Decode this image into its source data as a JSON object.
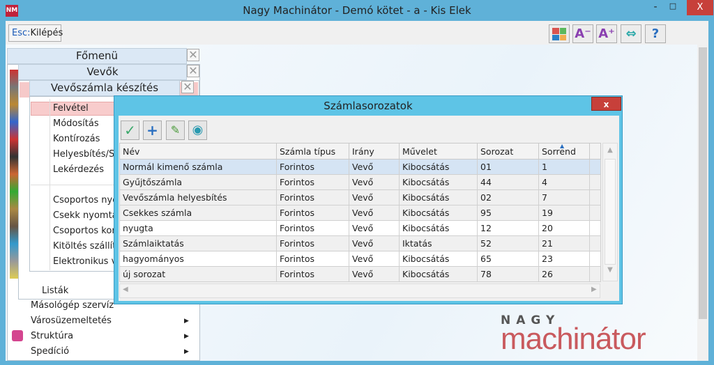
{
  "window": {
    "title": "Nagy Machinátor - Demó kötet - a - Kis Elek",
    "logo": "NM",
    "minimize": "-",
    "maximize": "□",
    "close": "X"
  },
  "toolbar": {
    "esc_key": "Esc:",
    "esc_label": "Kilépés",
    "buttons": [
      {
        "icon": "color-scheme-icon"
      },
      {
        "icon": "font-decrease-icon",
        "label": "A⁻"
      },
      {
        "icon": "font-increase-icon",
        "label": "A⁺"
      },
      {
        "icon": "resize-icon",
        "label": "⇔"
      },
      {
        "icon": "help-icon",
        "label": "?"
      }
    ]
  },
  "menus": {
    "fomenu": "Főmenü",
    "vevok": "Vevők",
    "vevoszamla": "Vevőszámla készítés",
    "close": "✕",
    "submenu": [
      "Felvétel",
      "Módosítás",
      "Kontírozás",
      "Helyesbítés/St",
      "Lekérdezés",
      "Csoportos nyo",
      "Csekk nyomta",
      "Csoportos kor",
      "Kitöltés szállít",
      "Elektronikus v"
    ],
    "listak": "Listák",
    "main_items": [
      "Másológép szervíz",
      "Városüzemeltetés",
      "Struktúra",
      "Spedíció"
    ],
    "arrow": "▶"
  },
  "dialog": {
    "title": "Számlasorozatok",
    "close": "x",
    "columns": [
      "Név",
      "Számla típus",
      "Irány",
      "Művelet",
      "Sorozat",
      "Sorrend"
    ],
    "rows": [
      [
        "Normál kimenő számla",
        "Forintos",
        "Vevő",
        "Kibocsátás",
        "01",
        "1"
      ],
      [
        "Gyűjtőszámla",
        "Forintos",
        "Vevő",
        "Kibocsátás",
        "44",
        "4"
      ],
      [
        "Vevőszámla helyesbítés",
        "Forintos",
        "Vevő",
        "Kibocsátás",
        "02",
        "7"
      ],
      [
        "Csekkes számla",
        "Forintos",
        "Vevő",
        "Kibocsátás",
        "95",
        "19"
      ],
      [
        "nyugta",
        "Forintos",
        "Vevő",
        "Kibocsátás",
        "12",
        "20"
      ],
      [
        "Számlaiktatás",
        "Forintos",
        "Vevő",
        "Iktatás",
        "52",
        "21"
      ],
      [
        "hagyományos",
        "Forintos",
        "Vevő",
        "Kibocsátás",
        "65",
        "23"
      ],
      [
        "új sorozat",
        "Forintos",
        "Vevő",
        "Kibocsátás",
        "78",
        "26"
      ]
    ]
  },
  "brand": {
    "top": "NAGY",
    "bottom": "machinátor"
  },
  "colors": {
    "titlebar": "#5fb1d8",
    "dialog": "#5ec4e6",
    "close": "#c7403a",
    "brand": "#c95a5e"
  }
}
